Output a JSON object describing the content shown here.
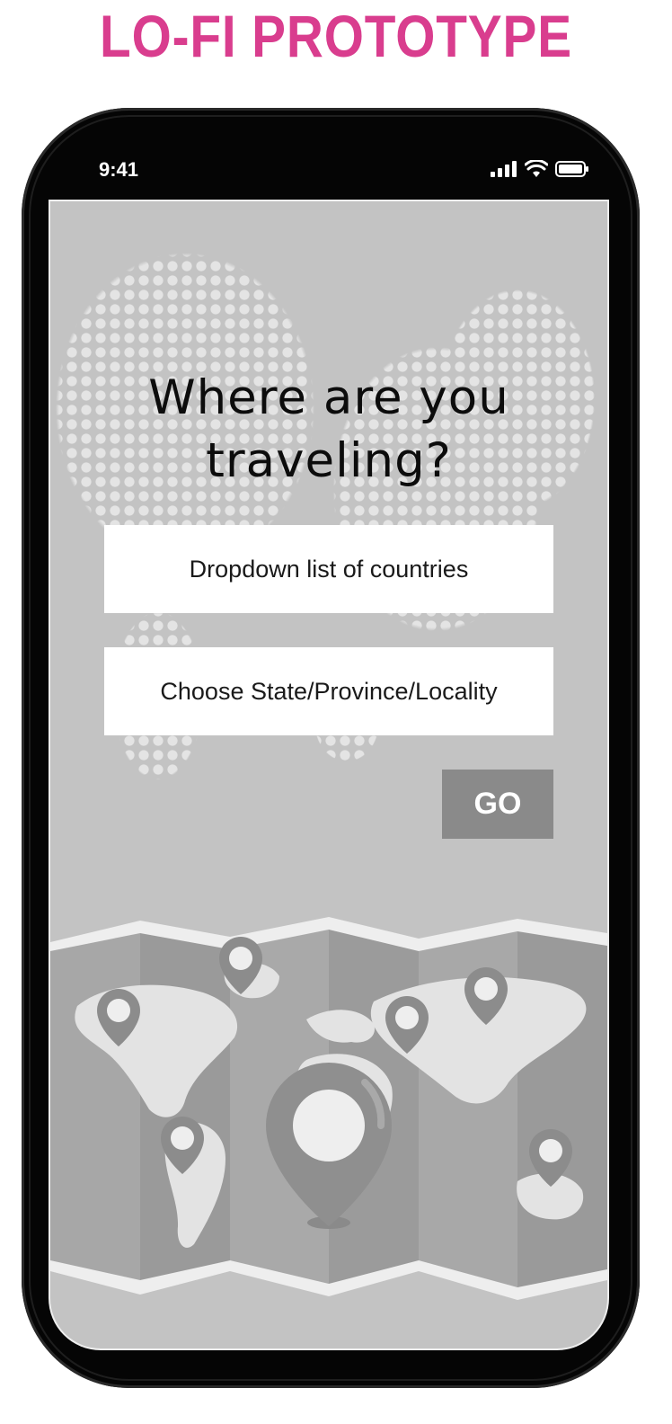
{
  "banner": {
    "title": "LO-FI PROTOTYPE"
  },
  "status_bar": {
    "time": "9:41",
    "icons": [
      "signal-icon",
      "wifi-icon",
      "battery-icon"
    ]
  },
  "screen": {
    "headline_line1": "Where are you",
    "headline_line2": "traveling?",
    "country_dropdown": {
      "label": "Dropdown list of countries"
    },
    "locality_dropdown": {
      "label": "Choose State/Province/Locality"
    },
    "go_button": {
      "label": "GO"
    }
  },
  "colors": {
    "banner": "#d93d8e",
    "screen_bg": "#c3c3c3",
    "go_button": "#8a8a8a",
    "map_pin": "#8c8c8c"
  }
}
